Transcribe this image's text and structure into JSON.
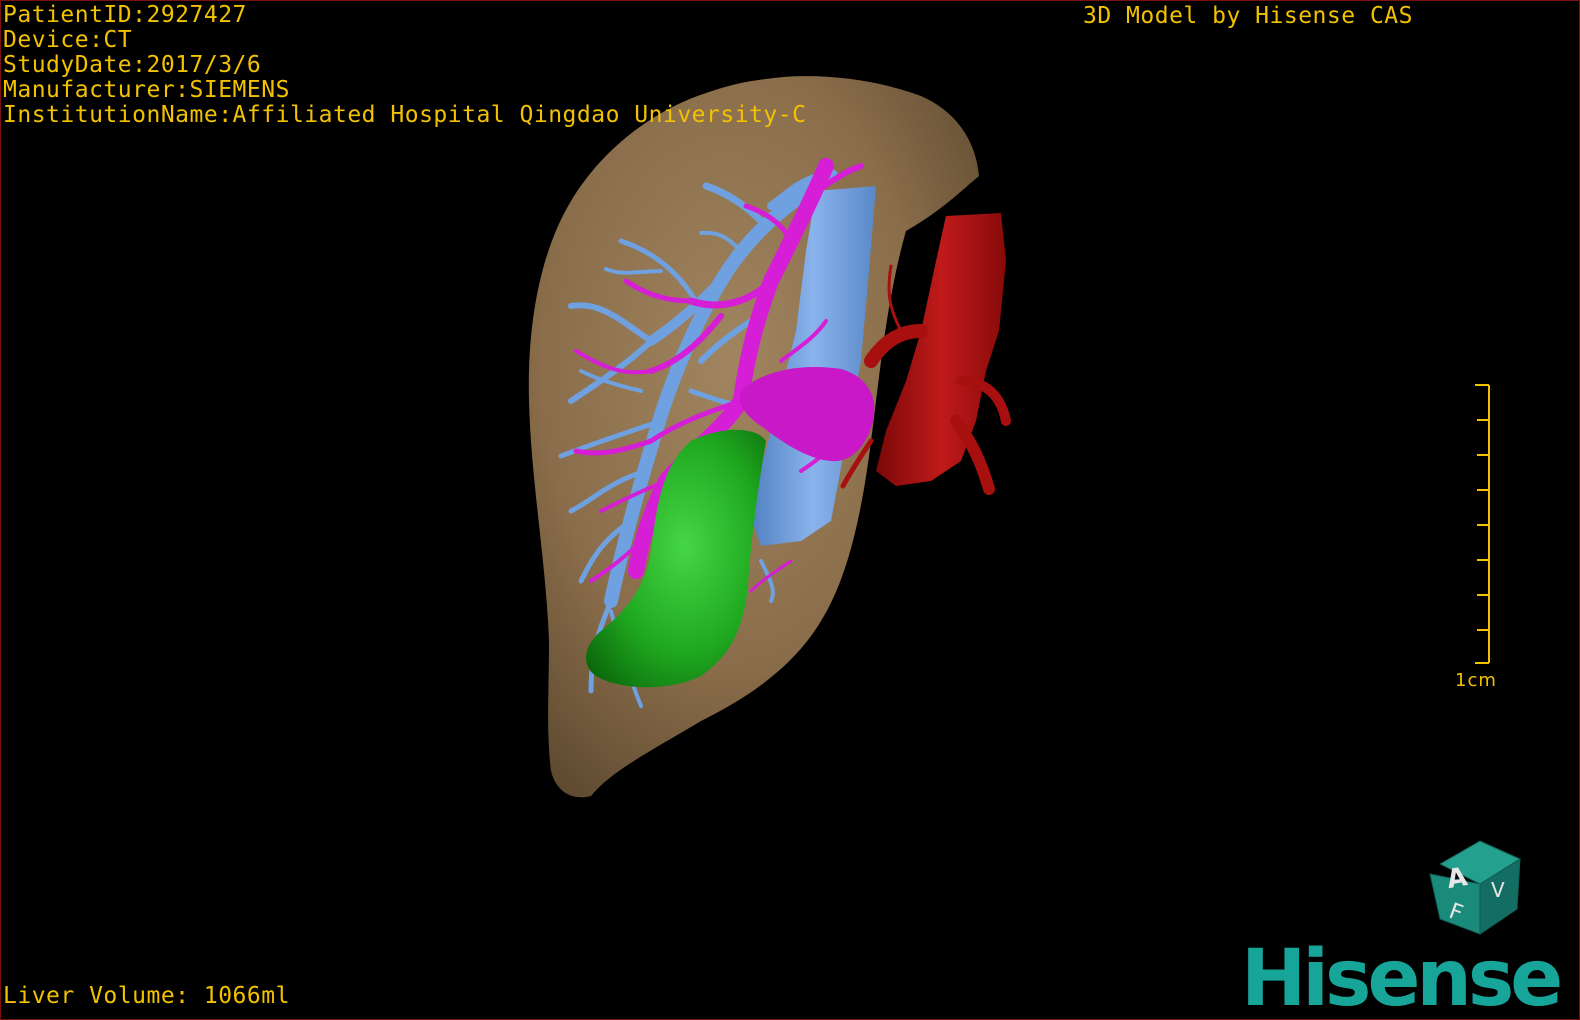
{
  "dicom_info": {
    "patient_id": "PatientID:2927427",
    "device": "Device:CT",
    "study_date": "StudyDate:2017/3/6",
    "manufacturer": "Manufacturer:SIEMENS",
    "institution": "InstitutionName:Affiliated Hospital Qingdao University-C"
  },
  "model_credit": "3D Model by Hisense CAS",
  "liver_volume": "Liver Volume: 1066ml",
  "scale_bar": {
    "label": "1cm",
    "color": "#f2c200"
  },
  "orientation_cube": {
    "face_front": "A",
    "face_bottom": "F",
    "face_side": "V",
    "color": "#1a8a7a"
  },
  "brand": {
    "name": "Hisense",
    "color": "#17a59a"
  },
  "structures": {
    "liver_color": "#8a6d4a",
    "portal_vein_color": "#6fa0e0",
    "hepatic_artery_color": "#d61ed6",
    "gallbladder_color": "#1fa81f",
    "aorta_color": "#a81010"
  }
}
